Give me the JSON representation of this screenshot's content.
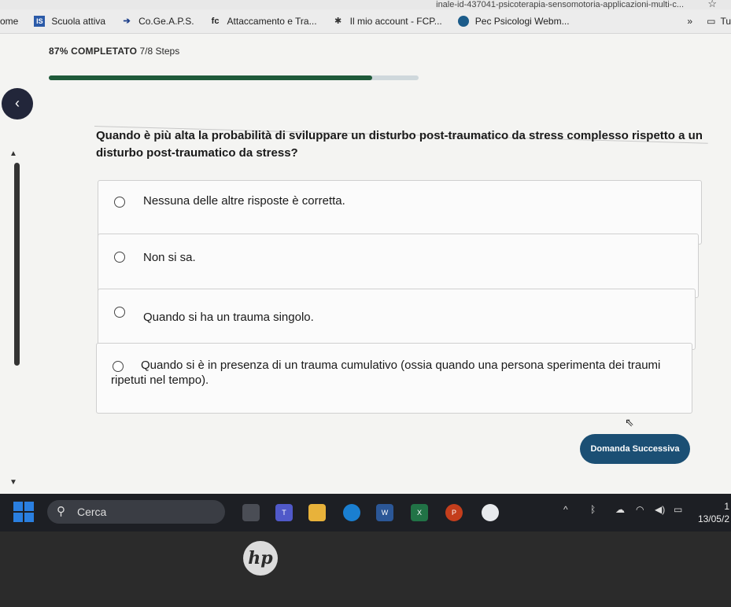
{
  "browser": {
    "url_fragment": "inale-id-437041-psicoterapia-sensomotoria-applicazioni-multi-c...",
    "bookmarks": [
      {
        "label": "ome",
        "icon": "home-icon"
      },
      {
        "label": "Scuola attiva",
        "icon": "is-logo-icon"
      },
      {
        "label": "Co.Ge.A.P.S.",
        "icon": "cogeaps-icon"
      },
      {
        "label": "Attaccamento e Tra...",
        "icon": "fc-logo-icon"
      },
      {
        "label": "Il mio account - FCP...",
        "icon": "tool-icon"
      },
      {
        "label": "Pec Psicologi Webm...",
        "icon": "pec-icon"
      }
    ],
    "more_bookmarks": "»",
    "folder_label": "Tu"
  },
  "progress": {
    "percent_label": "87% COMPLETATO",
    "steps_label": "7/8 Steps",
    "fraction": 0.875
  },
  "quiz": {
    "question": "Quando è più alta la probabilità di sviluppare un disturbo post-traumatico da stress complesso rispetto a un disturbo post-traumatico da stress?",
    "options": [
      "Nessuna delle altre risposte è corretta.",
      "Non si sa.",
      "Quando si ha un trauma singolo.",
      "Quando si è in presenza di un trauma cumulativo (ossia quando una persona sperimenta dei traumi ripetuti nel tempo)."
    ],
    "next_button": "Domanda Successiva"
  },
  "taskbar": {
    "search_placeholder": "Cerca",
    "date": "13/05/2",
    "time": "1"
  },
  "device": {
    "brand": "hp"
  },
  "colors": {
    "accent": "#1b4f74",
    "progress_fill": "#1f5a3a",
    "back_button": "#22263a"
  }
}
